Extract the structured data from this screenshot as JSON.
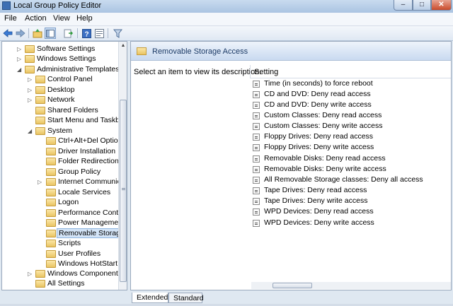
{
  "window": {
    "title": "Local Group Policy Editor",
    "min": "–",
    "max": "□",
    "close": "✕"
  },
  "menu": [
    "File",
    "Action",
    "View",
    "Help"
  ],
  "toolbar": [
    "back-icon",
    "forward-icon",
    "up-icon",
    "show-hide-tree-icon",
    "export-icon",
    "help-icon",
    "properties-icon",
    "filter-icon"
  ],
  "tree": [
    {
      "label": "Software Settings",
      "expander": "▷"
    },
    {
      "label": "Windows Settings",
      "expander": "▷"
    },
    {
      "label": "Administrative Templates",
      "expander": "◢"
    },
    {
      "label": "Control Panel",
      "expander": "▷"
    },
    {
      "label": "Desktop",
      "expander": "▷"
    },
    {
      "label": "Network",
      "expander": "▷"
    },
    {
      "label": "Shared Folders",
      "expander": ""
    },
    {
      "label": "Start Menu and Taskbar",
      "expander": ""
    },
    {
      "label": "System",
      "expander": "◢"
    },
    {
      "label": "Ctrl+Alt+Del Options",
      "expander": ""
    },
    {
      "label": "Driver Installation",
      "expander": ""
    },
    {
      "label": "Folder Redirection",
      "expander": ""
    },
    {
      "label": "Group Policy",
      "expander": ""
    },
    {
      "label": "Internet Communication",
      "expander": "▷"
    },
    {
      "label": "Locale Services",
      "expander": ""
    },
    {
      "label": "Logon",
      "expander": ""
    },
    {
      "label": "Performance Control",
      "expander": ""
    },
    {
      "label": "Power Management",
      "expander": ""
    },
    {
      "label": "Removable Storage",
      "expander": ""
    },
    {
      "label": "Scripts",
      "expander": ""
    },
    {
      "label": "User Profiles",
      "expander": ""
    },
    {
      "label": "Windows HotStart",
      "expander": ""
    },
    {
      "label": "Windows Components",
      "expander": "▷"
    },
    {
      "label": "All Settings",
      "expander": ""
    }
  ],
  "right": {
    "header_title": "Removable Storage Access",
    "description": "Select an item to view its description.",
    "column": "Setting",
    "settings": [
      "Time (in seconds) to force reboot",
      "CD and DVD: Deny read access",
      "CD and DVD: Deny write access",
      "Custom Classes: Deny read access",
      "Custom Classes: Deny write access",
      "Floppy Drives: Deny read access",
      "Floppy Drives: Deny write access",
      "Removable Disks: Deny read access",
      "Removable Disks: Deny write access",
      "All Removable Storage classes: Deny all access",
      "Tape Drives: Deny read access",
      "Tape Drives: Deny write access",
      "WPD Devices: Deny read access",
      "WPD Devices: Deny write access"
    ]
  },
  "tabs": [
    "Extended",
    "Standard"
  ]
}
